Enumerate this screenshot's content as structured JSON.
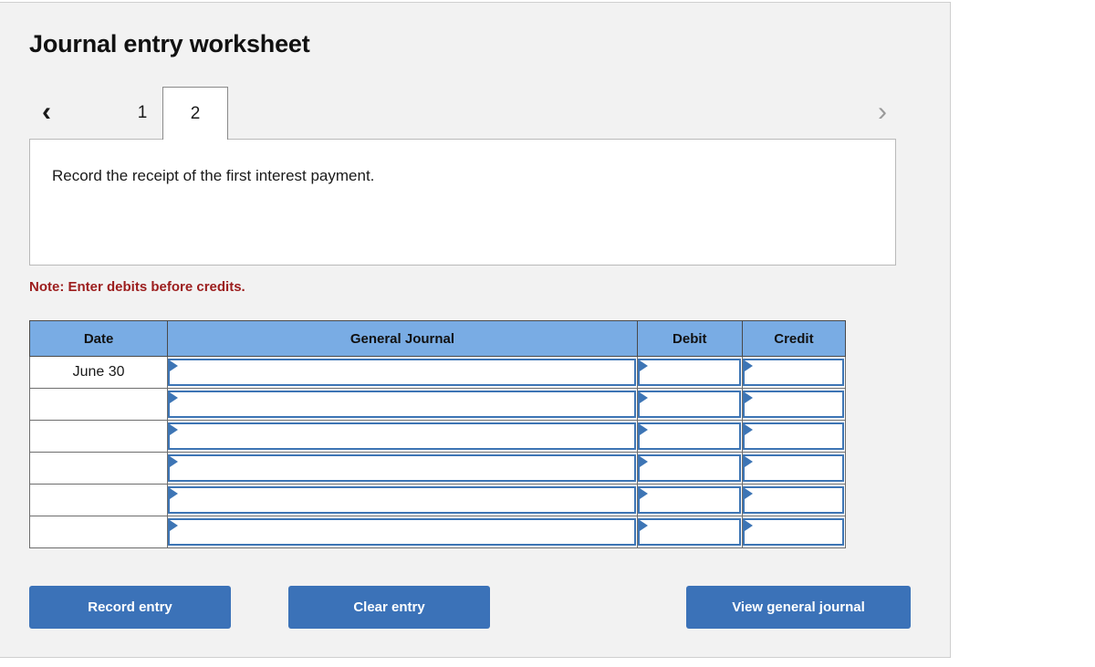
{
  "panel": {
    "title": "Journal entry worksheet"
  },
  "tabs": {
    "prev_icon": "chevron-left-icon",
    "next_icon": "chevron-right-icon",
    "prev_glyph": "‹",
    "next_glyph": "›",
    "items": [
      {
        "label": "1",
        "active": false
      },
      {
        "label": "2",
        "active": true
      }
    ]
  },
  "description": {
    "text": "Record the receipt of the first interest payment."
  },
  "note": {
    "text": "Note: Enter debits before credits."
  },
  "table": {
    "headers": [
      "Date",
      "General Journal",
      "Debit",
      "Credit"
    ],
    "rows": [
      {
        "date": "June 30",
        "general_journal": "",
        "debit": "",
        "credit": ""
      },
      {
        "date": "",
        "general_journal": "",
        "debit": "",
        "credit": ""
      },
      {
        "date": "",
        "general_journal": "",
        "debit": "",
        "credit": ""
      },
      {
        "date": "",
        "general_journal": "",
        "debit": "",
        "credit": ""
      },
      {
        "date": "",
        "general_journal": "",
        "debit": "",
        "credit": ""
      },
      {
        "date": "",
        "general_journal": "",
        "debit": "",
        "credit": ""
      }
    ]
  },
  "buttons": {
    "record": "Record entry",
    "clear": "Clear entry",
    "view": "View general journal"
  },
  "colors": {
    "header_blue": "#79ace4",
    "button_blue": "#3b72b8",
    "cell_border_blue": "#3d75b5",
    "note_red": "#9c1d1d",
    "panel_bg": "#f2f2f2"
  }
}
